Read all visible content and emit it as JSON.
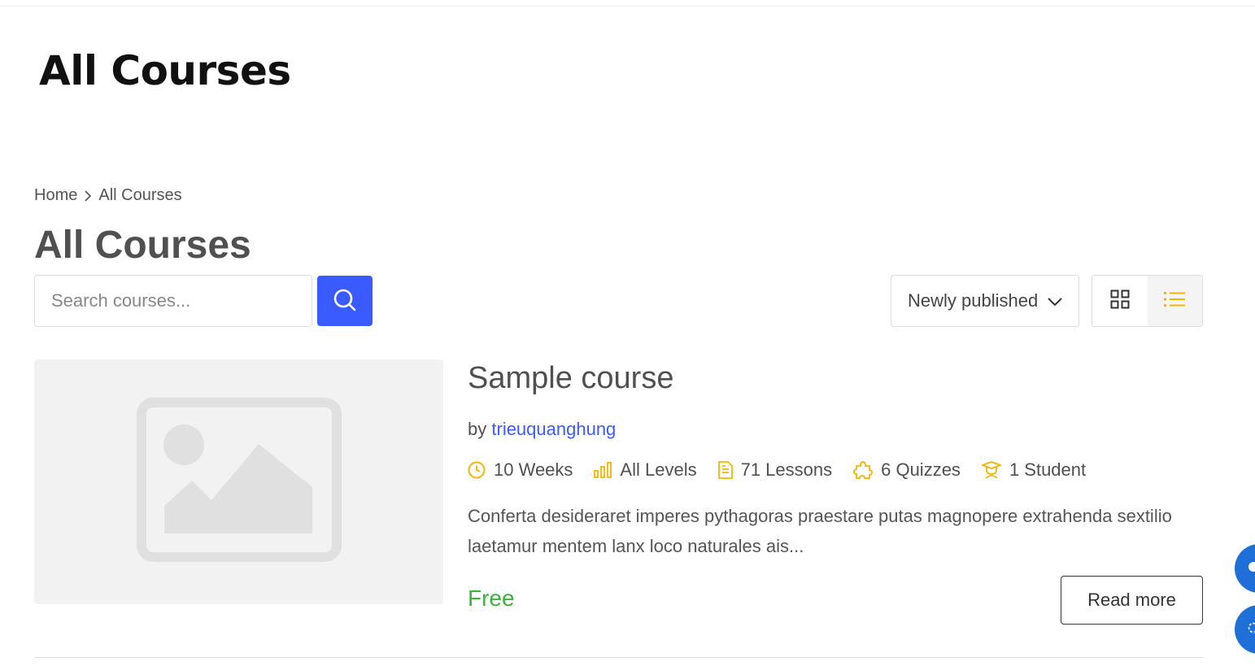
{
  "site": {
    "title": "All Courses"
  },
  "breadcrumb": {
    "home": "Home",
    "current": "All Courses"
  },
  "page": {
    "title": "All Courses"
  },
  "search": {
    "placeholder": "Search courses..."
  },
  "sort": {
    "selected": "Newly published"
  },
  "view": {
    "active": "list"
  },
  "course": {
    "title": "Sample course",
    "by_label": "by",
    "author": "trieuquanghung",
    "meta": {
      "duration": "10 Weeks",
      "level": "All Levels",
      "lessons": "71 Lessons",
      "quizzes": "6 Quizzes",
      "students": "1 Student"
    },
    "excerpt": "Conferta desideraret imperes pythagoras praestare putas magnopere extrahenda sextilio laetamur mentem lanx loco naturales ais...",
    "price": "Free",
    "read_more": "Read more"
  },
  "colors": {
    "accent": "#3a5bff",
    "meta_icon": "#f5b400",
    "price": "#3bb33b",
    "floating": "#1f6fd8"
  },
  "icons": [
    "search-icon",
    "chevron-down-icon",
    "grid-icon",
    "list-icon",
    "clock-icon",
    "bar-chart-icon",
    "file-icon",
    "puzzle-icon",
    "graduate-icon",
    "image-placeholder-icon",
    "chat-icon"
  ]
}
